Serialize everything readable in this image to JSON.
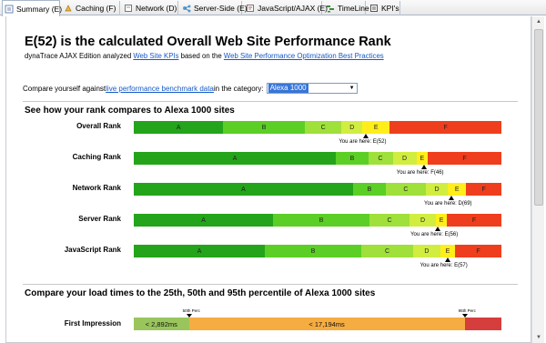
{
  "tabs": [
    {
      "label": "Summary (E)",
      "icon": "report-icon"
    },
    {
      "label": "Caching (F)",
      "icon": "caching-icon"
    },
    {
      "label": "Network (D)",
      "icon": "network-icon"
    },
    {
      "label": "Server-Side (E)",
      "icon": "server-icon"
    },
    {
      "label": "JavaScript/AJAX (E)",
      "icon": "javascript-icon"
    },
    {
      "label": "TimeLine",
      "icon": "timeline-icon"
    },
    {
      "label": "KPI's",
      "icon": "kpi-icon"
    }
  ],
  "header": {
    "title": "E(52) is the calculated Overall Web Site Performance Rank",
    "subtitle_pre": "dynaTrace AJAX Edition analyzed ",
    "subtitle_link1": "Web Site KPIs",
    "subtitle_mid": " based on the ",
    "subtitle_link2": "Web Site Performance Optimization Best Practices"
  },
  "compare": {
    "pre": "Compare yourself against ",
    "link": "live performance benchmark data",
    "post": " in the category:",
    "category_value": "Alexa 1000"
  },
  "rank_section": {
    "heading": "See how your rank compares to Alexa 1000 sites",
    "rows": [
      {
        "label": "Overall Rank",
        "segments": [
          {
            "grade": "A",
            "fraction": 0.258
          },
          {
            "grade": "B",
            "fraction": 0.235
          },
          {
            "grade": "C",
            "fraction": 0.106
          },
          {
            "grade": "D",
            "fraction": 0.06
          },
          {
            "grade": "E",
            "fraction": 0.079
          },
          {
            "grade": "F",
            "fraction": 0.322
          }
        ],
        "marker_fraction": 0.632,
        "you_are_here": "You are here: E(52)"
      },
      {
        "label": "Caching Rank",
        "segments": [
          {
            "grade": "A",
            "fraction": 0.571
          },
          {
            "grade": "B",
            "fraction": 0.091
          },
          {
            "grade": "C",
            "fraction": 0.069
          },
          {
            "grade": "D",
            "fraction": 0.067
          },
          {
            "grade": "E",
            "fraction": 0.032
          },
          {
            "grade": "F",
            "fraction": 0.208
          }
        ],
        "marker_fraction": 0.789,
        "you_are_here": "You are here: F(46)"
      },
      {
        "label": "Network Rank",
        "segments": [
          {
            "grade": "A",
            "fraction": 0.597
          },
          {
            "grade": "B",
            "fraction": 0.089
          },
          {
            "grade": "C",
            "fraction": 0.109
          },
          {
            "grade": "D",
            "fraction": 0.06
          },
          {
            "grade": "E",
            "fraction": 0.05
          },
          {
            "grade": "F",
            "fraction": 0.096
          }
        ],
        "marker_fraction": 0.864,
        "you_are_here": "You are here: D(69)"
      },
      {
        "label": "Server Rank",
        "segments": [
          {
            "grade": "A",
            "fraction": 0.379
          },
          {
            "grade": "B",
            "fraction": 0.262
          },
          {
            "grade": "C",
            "fraction": 0.109
          },
          {
            "grade": "D",
            "fraction": 0.072
          },
          {
            "grade": "E",
            "fraction": 0.03
          },
          {
            "grade": "F",
            "fraction": 0.148
          }
        ],
        "marker_fraction": 0.827,
        "you_are_here": "You are here: E(56)"
      },
      {
        "label": "JavaScript Rank",
        "segments": [
          {
            "grade": "A",
            "fraction": 0.357
          },
          {
            "grade": "B",
            "fraction": 0.262
          },
          {
            "grade": "C",
            "fraction": 0.141
          },
          {
            "grade": "D",
            "fraction": 0.074
          },
          {
            "grade": "E",
            "fraction": 0.04
          },
          {
            "grade": "F",
            "fraction": 0.126
          }
        ],
        "marker_fraction": 0.853,
        "you_are_here": "You are here: E(57)"
      }
    ]
  },
  "load_section": {
    "heading": "Compare your load times to the 25th, 50th and 95th percentile of Alexa 1000 sites",
    "rows": [
      {
        "label": "First Impression",
        "p25_label": "< 2,892ms",
        "p50_label": "< 17,194ms",
        "p25_fraction": 0.15,
        "p50_fraction": 0.75,
        "p95_fraction": 0.1,
        "p50_tag": "50th Perc",
        "p95_tag": "95th Perc"
      }
    ]
  },
  "colors": {
    "A": "#23a41a",
    "B": "#5bcf25",
    "C": "#9fe03a",
    "D": "#d1ed40",
    "E": "#ffee1a",
    "F": "#ef3e1d",
    "link": "#1559c9"
  }
}
